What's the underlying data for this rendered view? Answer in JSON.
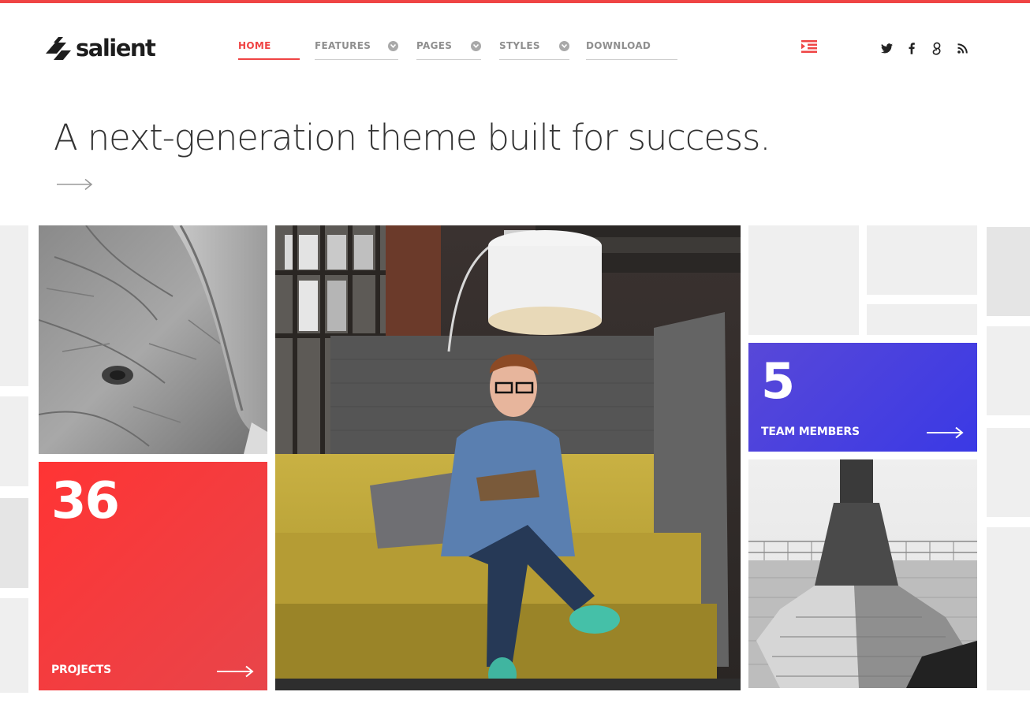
{
  "brand": {
    "name": "salient",
    "accent": "#ef4444"
  },
  "nav": {
    "items": [
      {
        "label": "HOME",
        "active": true,
        "has_dropdown": false
      },
      {
        "label": "FEATURES",
        "active": false,
        "has_dropdown": true
      },
      {
        "label": "PAGES",
        "active": false,
        "has_dropdown": true
      },
      {
        "label": "STYLES",
        "active": false,
        "has_dropdown": true
      },
      {
        "label": "DOWNLOAD",
        "active": false,
        "has_dropdown": false
      }
    ],
    "menu_icon": "indent-menu-icon"
  },
  "social": {
    "icons": [
      "twitter-icon",
      "facebook-icon",
      "google-plus-icon",
      "rss-icon"
    ]
  },
  "hero": {
    "title": "A next-generation theme built for success.",
    "arrow_icon": "arrow-right-icon"
  },
  "grid": {
    "images": [
      "elephant-photo",
      "office-man-photo",
      "pillar-photo"
    ],
    "stats": [
      {
        "number": "36",
        "label": "PROJECTS",
        "color_from": "#ff3434",
        "color_to": "#e8454a"
      },
      {
        "number": "5",
        "label": "TEAM MEMBERS",
        "color_from": "#5848d8",
        "color_to": "#3a39e5"
      }
    ]
  }
}
